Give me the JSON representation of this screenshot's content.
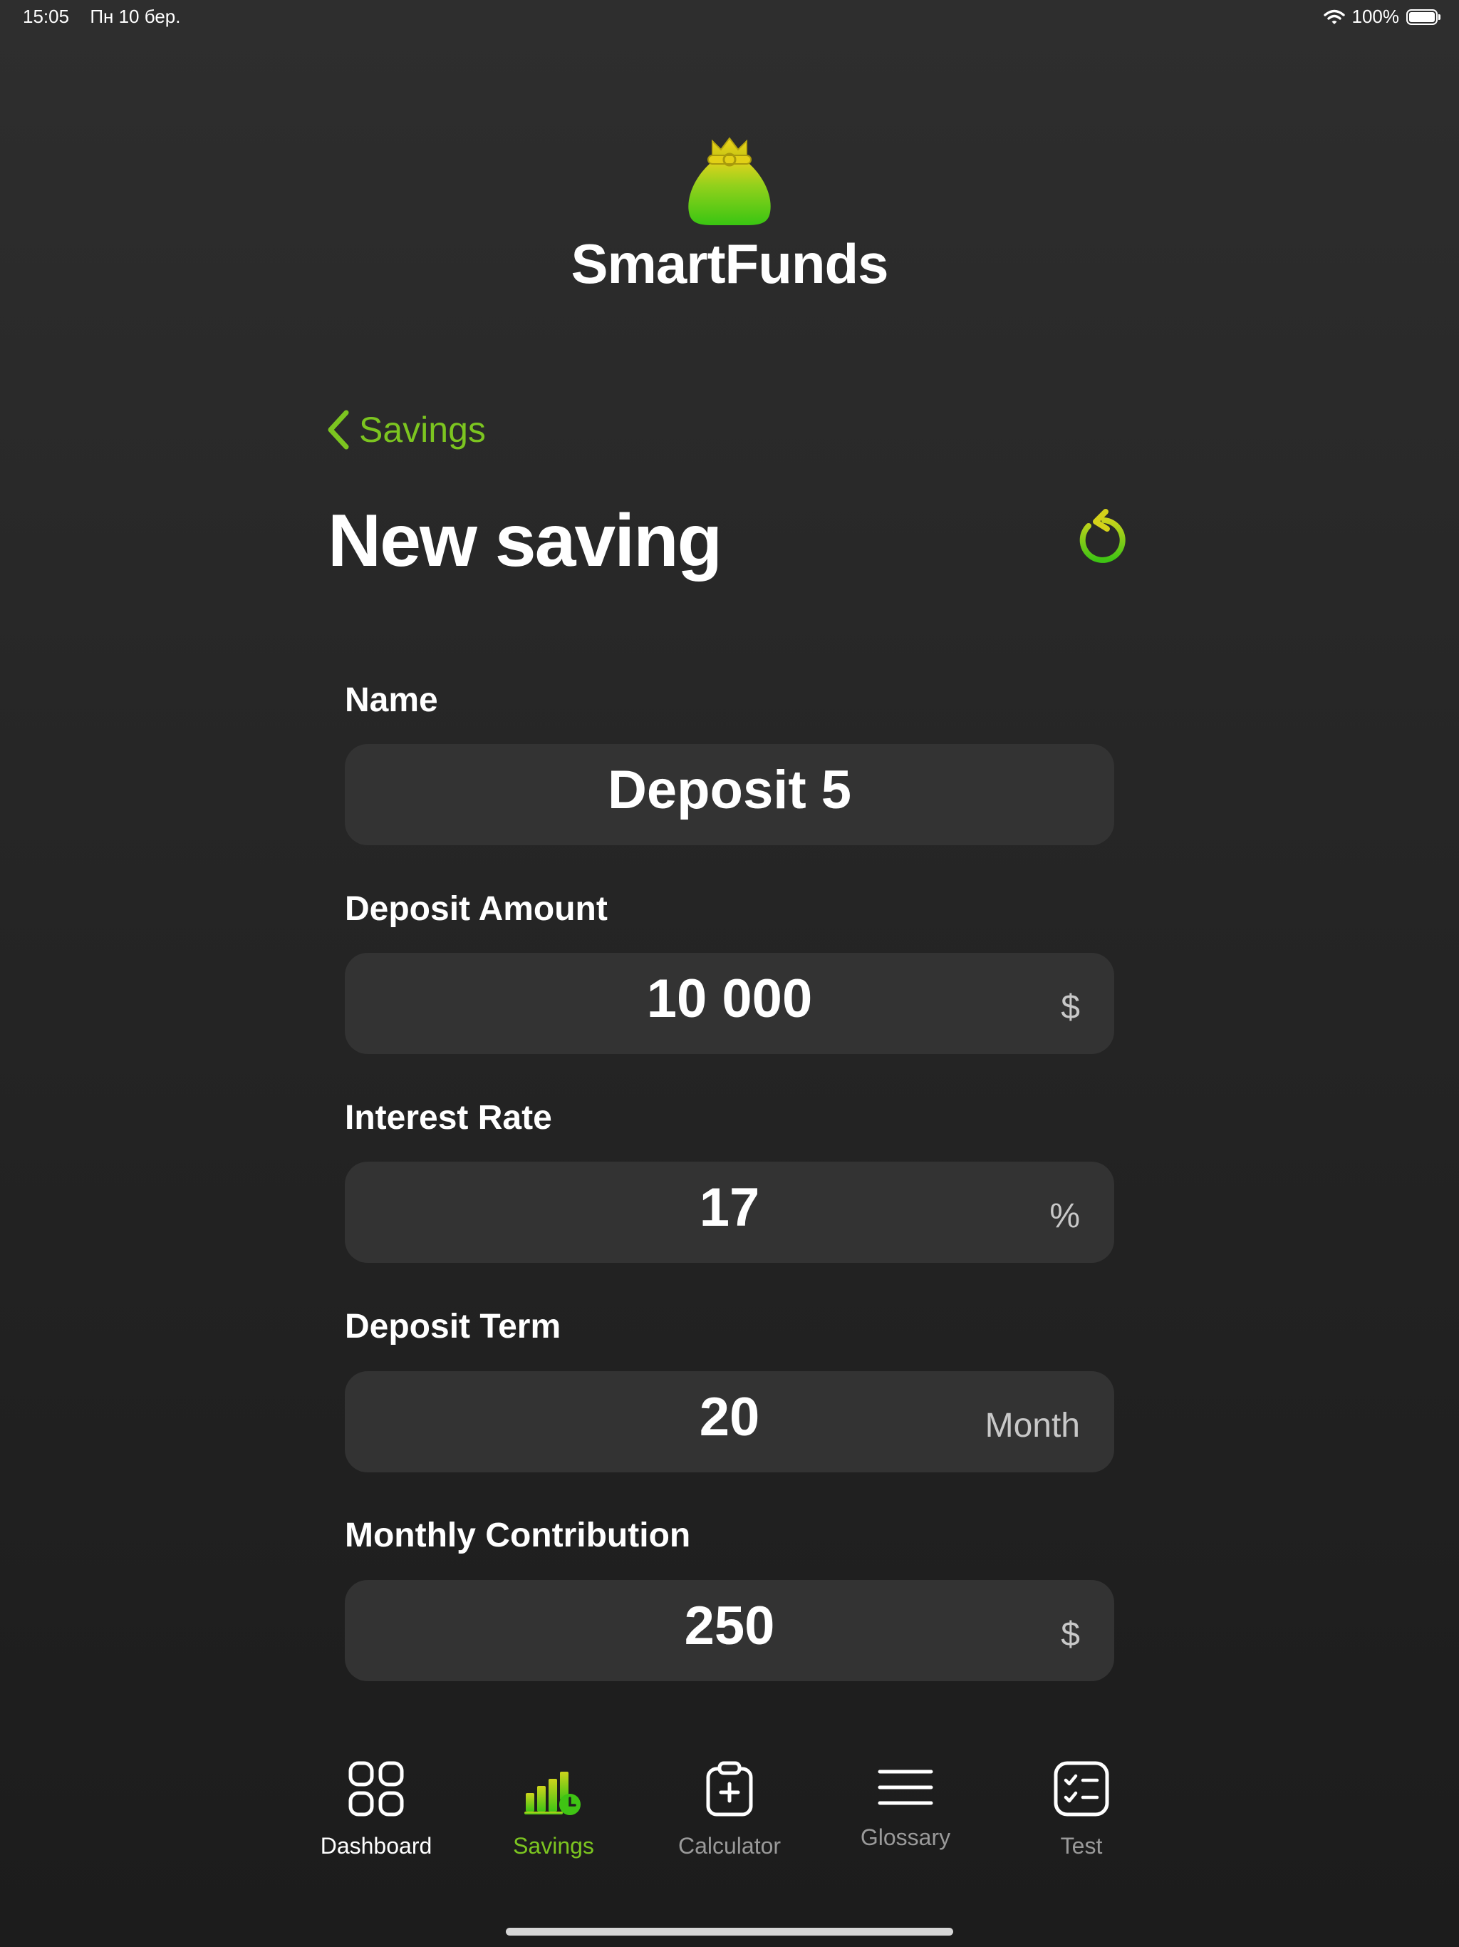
{
  "status_bar": {
    "time": "15:05",
    "date": "Пн 10 бер.",
    "battery": "100%"
  },
  "app": {
    "title": "SmartFunds",
    "logo_icon": "money-bag-icon"
  },
  "nav": {
    "back_label": "Savings"
  },
  "page": {
    "title": "New saving",
    "reset_icon": "reset-icon"
  },
  "form": {
    "name": {
      "label": "Name",
      "value": "Deposit 5",
      "unit": ""
    },
    "deposit_amount": {
      "label": "Deposit Amount",
      "value": "10 000",
      "unit": "$"
    },
    "interest_rate": {
      "label": "Interest Rate",
      "value": "17",
      "unit": "%"
    },
    "deposit_term": {
      "label": "Deposit Term",
      "value": "20",
      "unit": "Month"
    },
    "monthly_contribution": {
      "label": "Monthly Contribution",
      "value": "250",
      "unit": "$"
    }
  },
  "tabs": [
    {
      "label": "Dashboard",
      "icon": "grid-icon",
      "active": false
    },
    {
      "label": "Savings",
      "icon": "chart-icon",
      "active": true
    },
    {
      "label": "Calculator",
      "icon": "clipboard-plus-icon",
      "active": false
    },
    {
      "label": "Glossary",
      "icon": "menu-lines-icon",
      "active": false
    },
    {
      "label": "Test",
      "icon": "checklist-icon",
      "active": false
    }
  ],
  "colors": {
    "accent": "#7cc520",
    "field_bg": "#333333",
    "inactive_tab": "#9a9a9a",
    "dashboard_tab": "#ffffff"
  }
}
